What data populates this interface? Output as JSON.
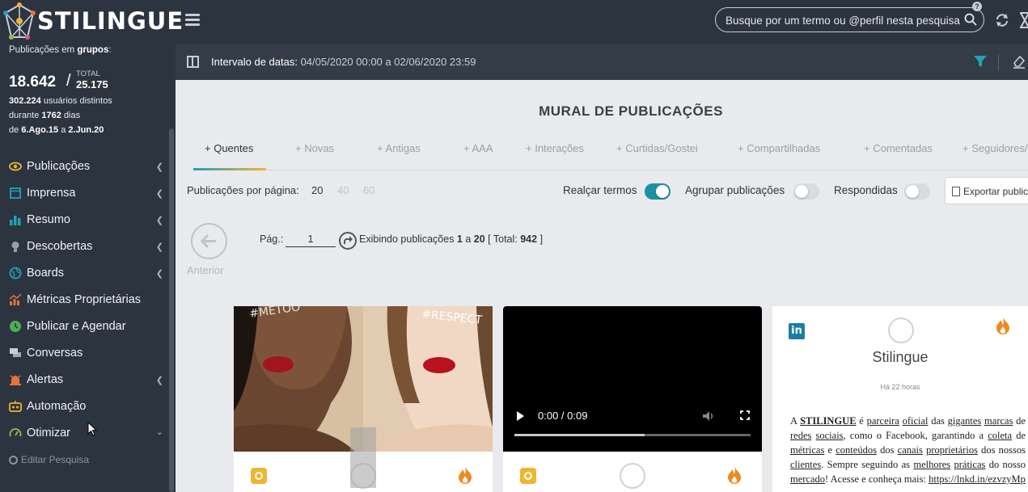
{
  "app": {
    "brand": "STILINGUE"
  },
  "search": {
    "placeholder": "Busque por um termo ou @perfil nesta pesquisa"
  },
  "stats": {
    "line1_pre": "Publicações em ",
    "line1_bold": "grupos",
    "line1_post": ":",
    "count": "18.642",
    "total_label": "TOTAL",
    "total": "25.175",
    "users_bold": "302.224",
    "users_text": " usuários distintos",
    "during_text": "durante ",
    "days_bold": "1762",
    "days_text": " dias",
    "from_text": "de ",
    "from_bold": "6.Ago.15",
    "to_text": " a ",
    "to_bold": "2.Jun.20"
  },
  "menu": [
    {
      "label": "Publicações",
      "icon": "eye-icon",
      "chevron": "left",
      "color": "#f0b530"
    },
    {
      "label": "Imprensa",
      "icon": "newspaper-icon",
      "chevron": "left",
      "color": "#1fa3b5"
    },
    {
      "label": "Resumo",
      "icon": "bar-chart-icon",
      "chevron": "left",
      "color": "#1fa3b5"
    },
    {
      "label": "Descobertas",
      "icon": "lightbulb-icon",
      "chevron": "left",
      "color": "#9aa0a8"
    },
    {
      "label": "Boards",
      "icon": "globe-icon",
      "chevron": "left",
      "color": "#1fa3b5"
    },
    {
      "label": "Métricas Proprietárias",
      "icon": "metrics-icon",
      "chevron": "",
      "color": "#e5743a"
    },
    {
      "label": "Publicar e Agendar",
      "icon": "clock-icon",
      "chevron": "",
      "color": "#4caf50"
    },
    {
      "label": "Conversas",
      "icon": "chat-icon",
      "chevron": "",
      "color": "#c9ced6"
    },
    {
      "label": "Alertas",
      "icon": "alarm-icon",
      "chevron": "left",
      "color": "#e5743a"
    },
    {
      "label": "Automação",
      "icon": "robot-icon",
      "chevron": "",
      "color": "#f0b530"
    },
    {
      "label": "Otimizar",
      "icon": "gauge-icon",
      "chevron": "down",
      "color": "#8bc34a"
    }
  ],
  "edit_search": "Editar Pesquisa",
  "filter": {
    "label": "Intervalo de datas:",
    "value": " 04/05/2020 00:00 a 02/06/2020 23:59"
  },
  "page_title": "MURAL DE PUBLICAÇÕES",
  "tabs": [
    {
      "label": "+ Quentes",
      "active": true
    },
    {
      "label": "+ Novas"
    },
    {
      "label": "+ Antigas"
    },
    {
      "label": "+ AAA"
    },
    {
      "label": "+ Interações"
    },
    {
      "label": "+ Curtidas/Gostei"
    },
    {
      "label": "+ Compartilhadas"
    },
    {
      "label": "+ Comentadas"
    },
    {
      "label": "+ Seguidores/"
    }
  ],
  "per_page": {
    "label": "Publicações por página:",
    "options": [
      "20",
      "40",
      "60"
    ],
    "selected": "20"
  },
  "toggles": [
    {
      "label": "Realçar termos",
      "on": true
    },
    {
      "label": "Agrupar publicações",
      "on": false
    },
    {
      "label": "Respondidas",
      "on": false
    }
  ],
  "export_label": "Exportar public",
  "pagination": {
    "prev_label": "Anterior",
    "page_label": "Pág.:",
    "page_value": "1",
    "showing_pre": "Exibindo publicações ",
    "from": "1",
    "mid": " a ",
    "to": "20",
    "total_pre": " [ Total: ",
    "total": "942",
    "total_post": " ]"
  },
  "cards": {
    "image_caption_left": "#METOO",
    "image_caption_right": "#RESPECT",
    "video_time": "0:00 / 0:09",
    "video_progress": 0.55,
    "linkedin_name": "Stilingue",
    "linkedin_time": "Há 22 horas",
    "linkedin_text": [
      {
        "t": "A ",
        "u": false
      },
      {
        "t": "STILINGUE",
        "u": true,
        "b": true
      },
      {
        "t": " é ",
        "u": false
      },
      {
        "t": "parceira",
        "u": true
      },
      {
        "t": " ",
        "u": false
      },
      {
        "t": "oficial",
        "u": true
      },
      {
        "t": " das ",
        "u": false
      },
      {
        "t": "gigantes",
        "u": true
      },
      {
        "t": " ",
        "u": false
      },
      {
        "t": "marcas",
        "u": true
      },
      {
        "t": " de ",
        "u": false
      },
      {
        "t": "redes",
        "u": true
      },
      {
        "t": " ",
        "u": false
      },
      {
        "t": "sociais",
        "u": true
      },
      {
        "t": ", como o Facebook, garantindo a ",
        "u": false
      },
      {
        "t": "coleta",
        "u": true
      },
      {
        "t": " de ",
        "u": false
      },
      {
        "t": "métricas",
        "u": true
      },
      {
        "t": " e ",
        "u": false
      },
      {
        "t": "conteúdos",
        "u": true
      },
      {
        "t": " dos ",
        "u": false
      },
      {
        "t": "canais",
        "u": true
      },
      {
        "t": " ",
        "u": false
      },
      {
        "t": "proprietários",
        "u": true
      },
      {
        "t": " dos nossos ",
        "u": false
      },
      {
        "t": "clientes",
        "u": true
      },
      {
        "t": ". Sempre seguindo as ",
        "u": false
      },
      {
        "t": "melhores",
        "u": true
      },
      {
        "t": " ",
        "u": false
      },
      {
        "t": "práticas",
        "u": true
      },
      {
        "t": " do nosso ",
        "u": false
      },
      {
        "t": "mercado",
        "u": true
      },
      {
        "t": "! Acesse e conheça mais: ",
        "u": false
      },
      {
        "t": "https://lnkd.in/ezvzyMp",
        "u": true
      }
    ]
  }
}
